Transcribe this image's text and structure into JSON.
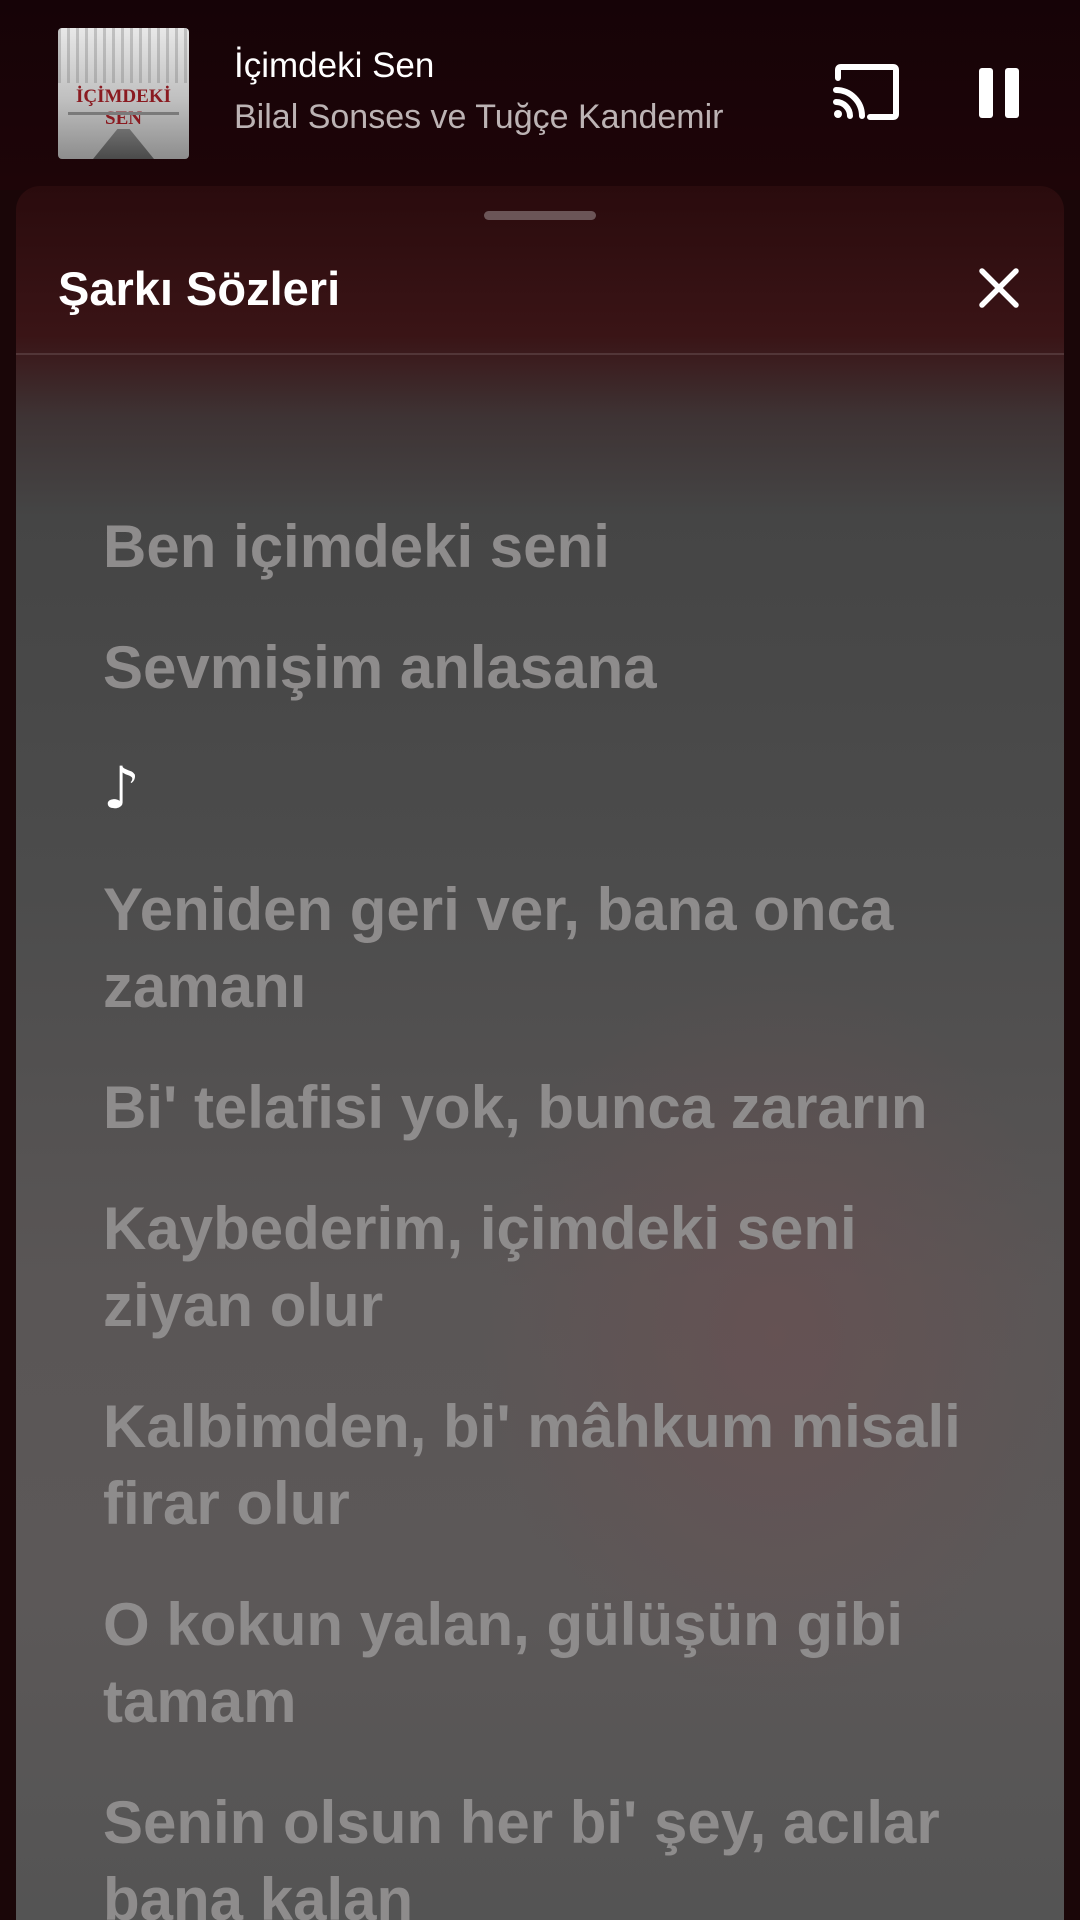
{
  "now_playing": {
    "title": "İçimdeki Sen",
    "artist": "Bilal Sonses ve Tuğçe Kandemir",
    "album_art_text": "İÇİMDEKİ SEN",
    "cast_icon": "cast-icon",
    "pause_icon": "pause-icon",
    "accent_color": "#1e0508"
  },
  "lyrics_sheet": {
    "title": "Şarkı Sözleri",
    "close_icon": "close-icon",
    "lines": [
      {
        "text": "Ben içimdeki seni",
        "active": false
      },
      {
        "text": "Sevmişim anlasana",
        "active": false
      },
      {
        "text": "♪",
        "active": true
      },
      {
        "text": "Yeniden geri ver, bana onca zamanı",
        "active": false
      },
      {
        "text": "Bi' telafisi yok, bunca zararın",
        "active": false
      },
      {
        "text": "Kaybederim, içimdeki seni ziyan olur",
        "active": false
      },
      {
        "text": "Kalbimden, bi' mâhkum misali firar olur",
        "active": false
      },
      {
        "text": "O kokun yalan, gülüşün gibi tamam",
        "active": false
      },
      {
        "text": "Senin olsun her bi' şey, acılar bana kalan",
        "active": false
      }
    ],
    "active_color": "#ffffff",
    "inactive_color": "#8e8c8c"
  }
}
